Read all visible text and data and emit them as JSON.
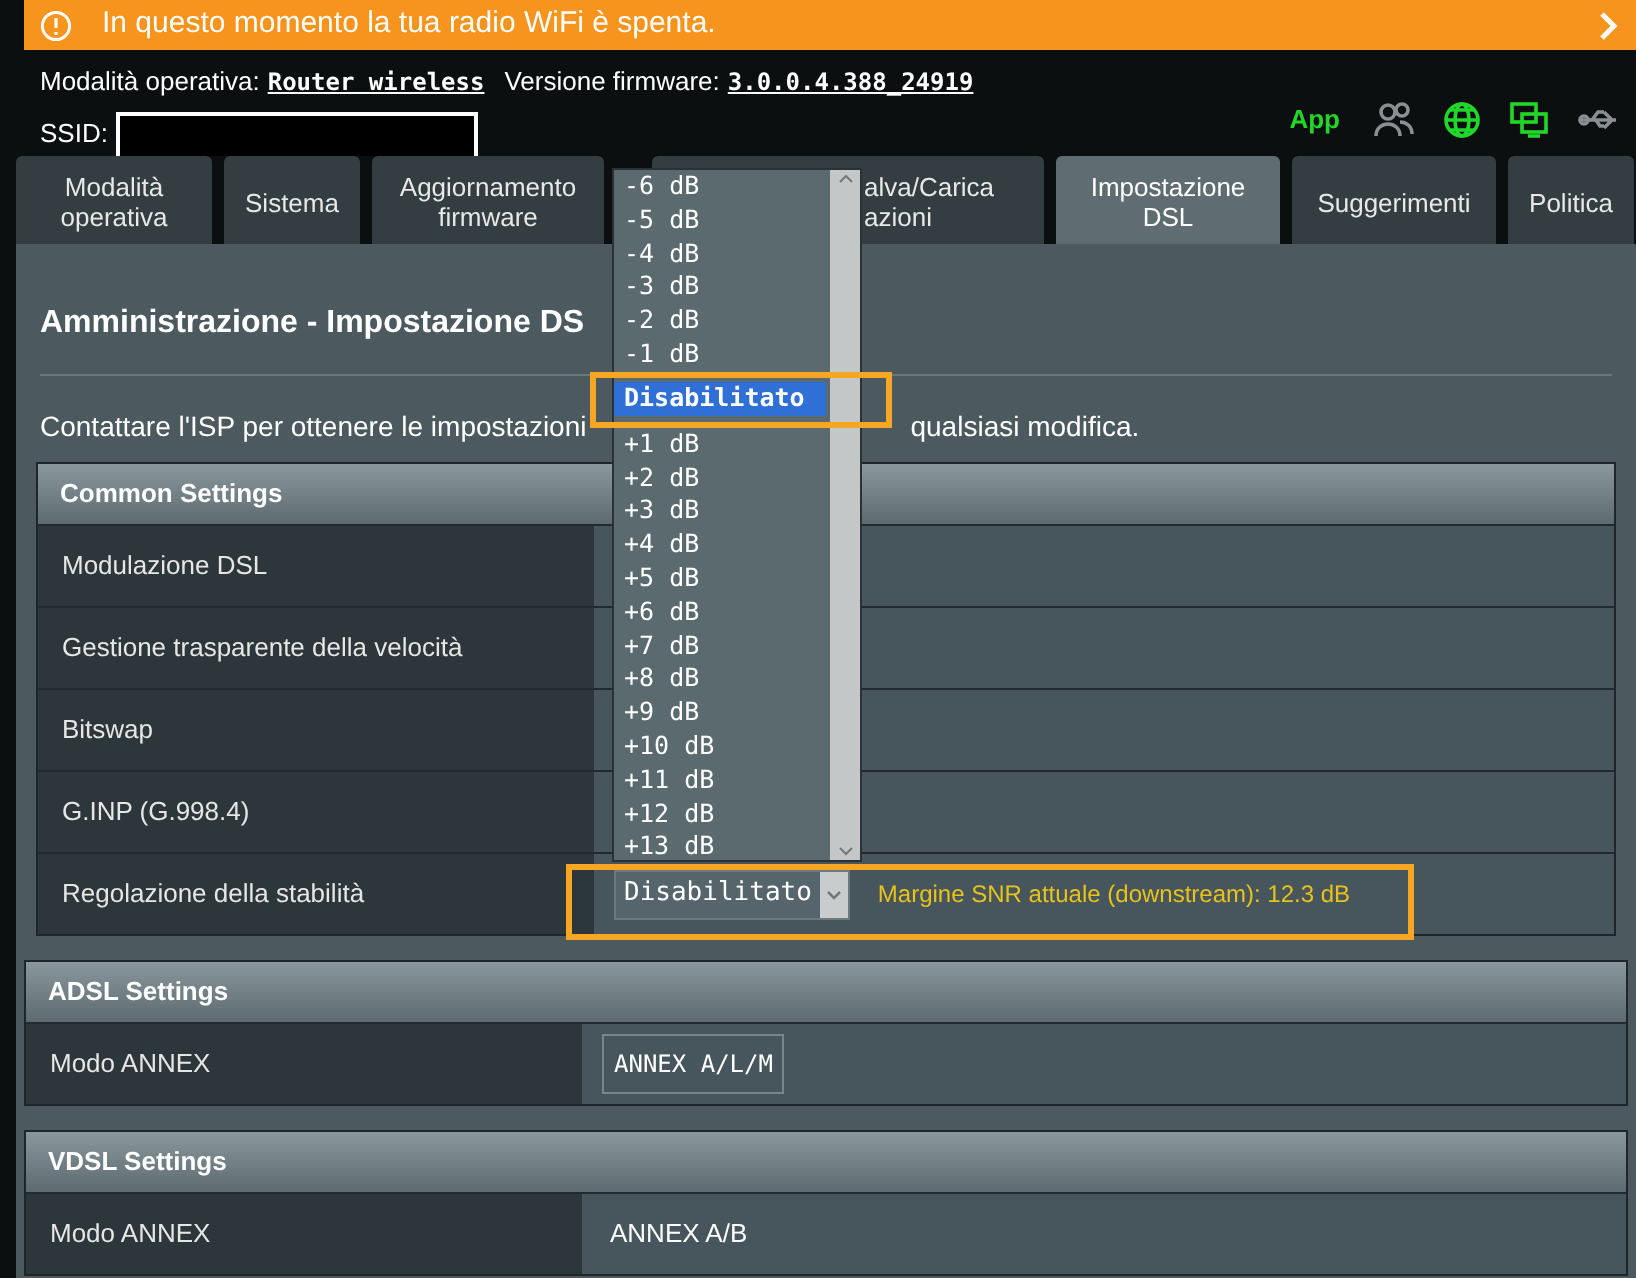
{
  "notice": {
    "text": "In questo momento la tua radio WiFi è spenta."
  },
  "header": {
    "mode_label": "Modalità operativa:",
    "mode_value": "Router wireless",
    "firmware_label": "Versione firmware:",
    "firmware_value": "3.0.0.4.388_24919",
    "ssid_label": "SSID:",
    "app_label": "App",
    "status_icons": [
      {
        "kind": "users",
        "active": false
      },
      {
        "kind": "globe",
        "active": true
      },
      {
        "kind": "monitor",
        "active": true
      },
      {
        "kind": "usb",
        "active": false
      }
    ]
  },
  "tabs": [
    {
      "lines": [
        "Modalità",
        "operativa"
      ],
      "selected": false
    },
    {
      "lines": [
        "Sistema"
      ],
      "selected": false
    },
    {
      "lines": [
        "Aggiornamento",
        "firmware"
      ],
      "selected": false
    },
    {
      "lines": [
        "alva/Carica",
        "azioni"
      ],
      "selected": false
    },
    {
      "lines": [
        "Impostazione",
        "DSL"
      ],
      "selected": true
    },
    {
      "lines": [
        "Suggerimenti"
      ],
      "selected": false
    },
    {
      "lines": [
        "Politica"
      ],
      "selected": false
    }
  ],
  "title": "Amministrazione - Impostazione DS",
  "intro": [
    "Contattare l'ISP per ottenere le impostazioni",
    "qualsiasi modifica."
  ],
  "sections": [
    {
      "title": "Common Settings",
      "rows": [
        {
          "label": "Modulazione DSL"
        },
        {
          "label": "Gestione trasparente della velocità"
        },
        {
          "label": "Bitswap"
        },
        {
          "label": "G.INP (G.998.4)"
        },
        {
          "label": "Regolazione della stabilità",
          "kind": "select",
          "value": "Disabilitato",
          "note": "Margine SNR attuale (downstream): 12.3 dB"
        }
      ]
    },
    {
      "title": "ADSL Settings",
      "rows": [
        {
          "label": "Modo ANNEX",
          "kind": "box",
          "value": "ANNEX A/L/M"
        }
      ]
    },
    {
      "title": "VDSL Settings",
      "rows": [
        {
          "label": "Modo ANNEX",
          "kind": "text",
          "value": "ANNEX A/B"
        }
      ]
    }
  ],
  "dropdown": {
    "options": [
      {
        "label": "-6 dB",
        "selected": false
      },
      {
        "label": "-5 dB",
        "selected": false
      },
      {
        "label": "-4 dB",
        "selected": false
      },
      {
        "label": "-3 dB",
        "selected": false
      },
      {
        "label": "-2 dB",
        "selected": false
      },
      {
        "label": "-1 dB",
        "selected": false
      },
      {
        "label": "Disabilitato",
        "selected": true
      },
      {
        "label": "+1 dB",
        "selected": false
      },
      {
        "label": "+2 dB",
        "selected": false
      },
      {
        "label": "+3 dB",
        "selected": false
      },
      {
        "label": "+4 dB",
        "selected": false
      },
      {
        "label": "+5 dB",
        "selected": false
      },
      {
        "label": "+6 dB",
        "selected": false
      },
      {
        "label": "+7 dB",
        "selected": false
      },
      {
        "label": "+8 dB",
        "selected": false
      },
      {
        "label": "+9 dB",
        "selected": false
      },
      {
        "label": "+10 dB",
        "selected": false
      },
      {
        "label": "+11 dB",
        "selected": false
      },
      {
        "label": "+12 dB",
        "selected": false
      },
      {
        "label": "+13 dB",
        "selected": false
      }
    ]
  }
}
